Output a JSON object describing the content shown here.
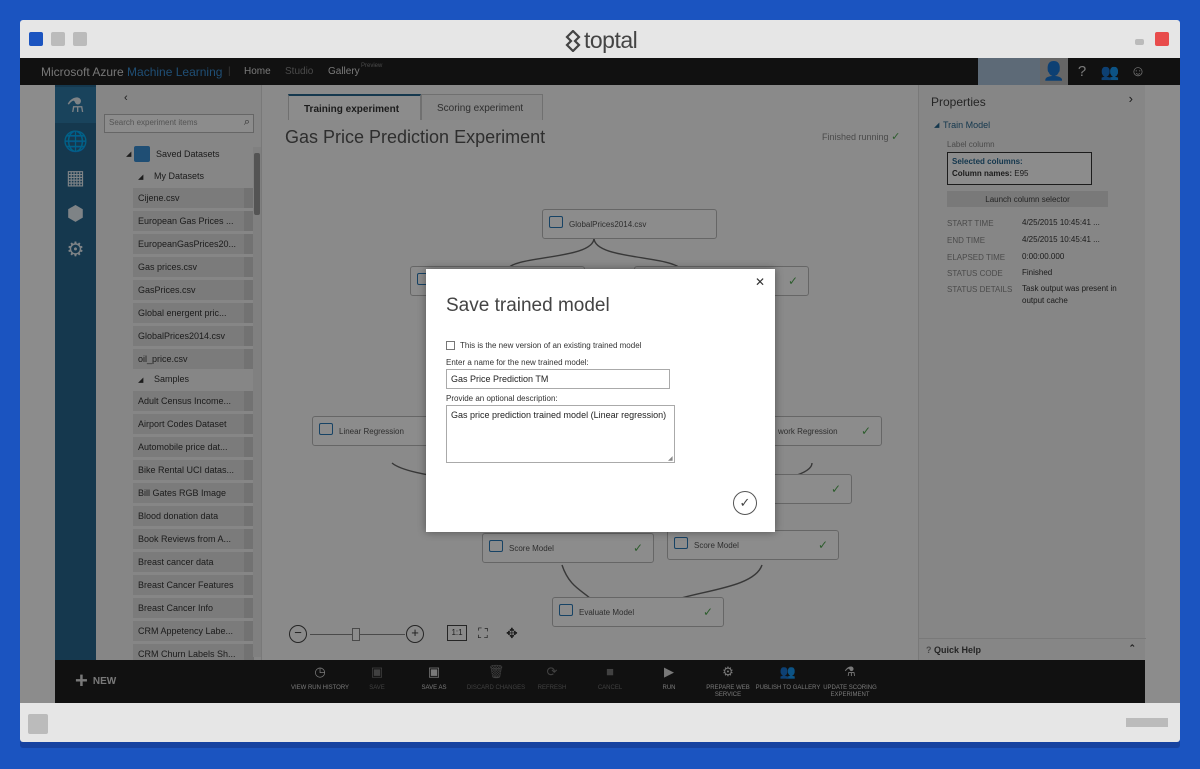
{
  "window": {
    "brand": "toptal"
  },
  "topbar": {
    "brand_main": "Microsoft Azure ",
    "brand_accent": "Machine Learning",
    "sep": "|",
    "nav": [
      "Home",
      "Studio",
      "Gallery"
    ],
    "gallery_sup": "Preview"
  },
  "leftnav": {
    "icons": [
      "flask-icon",
      "globe-icon",
      "cubes-icon",
      "cube-icon",
      "gear-icon"
    ]
  },
  "palette": {
    "search_placeholder": "Search experiment items",
    "saved_datasets": "Saved Datasets",
    "my_datasets": "My Datasets",
    "my_items": [
      "Cijene.csv",
      "European Gas Prices ...",
      "EuropeanGasPrices20...",
      "Gas prices.csv",
      "GasPrices.csv",
      "Global energent pric...",
      "GlobalPrices2014.csv",
      "oil_price.csv"
    ],
    "samples": "Samples",
    "sample_items": [
      "Adult Census Income...",
      "Airport Codes Dataset",
      "Automobile price dat...",
      "Bike Rental UCI datas...",
      "Bill Gates RGB Image",
      "Blood donation data",
      "Book Reviews from A...",
      "Breast cancer data",
      "Breast Cancer Features",
      "Breast Cancer Info",
      "CRM Appetency Labe...",
      "CRM Churn Labels Sh..."
    ]
  },
  "canvas": {
    "tabs": [
      "Training experiment",
      "Scoring experiment"
    ],
    "title": "Gas Price Prediction Experiment",
    "status": "Finished running",
    "modules": {
      "global": "GlobalPrices2014.csv",
      "linear": "Linear Regression",
      "network": "work Regression",
      "score1": "Score Model",
      "score2": "Score Model",
      "evaluate": "Evaluate Model"
    },
    "zoom": {
      "ratio": "1:1"
    }
  },
  "properties": {
    "title": "Properties",
    "section": "Train Model",
    "label_column": "Label column",
    "selected": "Selected columns:",
    "colnames_label": "Column names:",
    "colnames_val": " E95",
    "launch": "Launch column selector",
    "rows": [
      {
        "k": "START TIME",
        "v": "4/25/2015 10:45:41 ..."
      },
      {
        "k": "END TIME",
        "v": "4/25/2015 10:45:41 ..."
      },
      {
        "k": "ELAPSED TIME",
        "v": "0:00:00.000"
      },
      {
        "k": "STATUS CODE",
        "v": "Finished"
      },
      {
        "k": "STATUS DETAILS",
        "v": "Task output was present in output cache"
      }
    ],
    "quick_help": "Quick Help"
  },
  "cmdbar": {
    "new": "NEW",
    "items": [
      {
        "label": "VIEW RUN HISTORY",
        "icon": "◷",
        "dis": false
      },
      {
        "label": "SAVE",
        "icon": "▣",
        "dis": true
      },
      {
        "label": "SAVE AS",
        "icon": "▣",
        "dis": false
      },
      {
        "label": "DISCARD CHANGES",
        "icon": "🗑",
        "dis": true
      },
      {
        "label": "REFRESH",
        "icon": "⟳",
        "dis": true
      },
      {
        "label": "CANCEL",
        "icon": "■",
        "dis": true
      },
      {
        "label": "RUN",
        "icon": "▶",
        "dis": false
      },
      {
        "label": "PREPARE WEB SERVICE",
        "icon": "⚙",
        "dis": false
      },
      {
        "label": "PUBLISH TO GALLERY",
        "icon": "👥",
        "dis": false
      },
      {
        "label": "UPDATE SCORING EXPERIMENT",
        "icon": "⚗",
        "dis": false
      }
    ]
  },
  "dialog": {
    "title": "Save trained model",
    "checkbox_label": "This is the new version of an existing trained model",
    "name_label": "Enter a name for the new trained model:",
    "name_value": "Gas Price Prediction TM",
    "desc_label": "Provide an optional description:",
    "desc_value": "Gas price prediction trained model (Linear regression)"
  },
  "colors": {
    "accent": "#27668f",
    "background": "#1b54c0",
    "brand_accent": "#3a8fd4"
  }
}
